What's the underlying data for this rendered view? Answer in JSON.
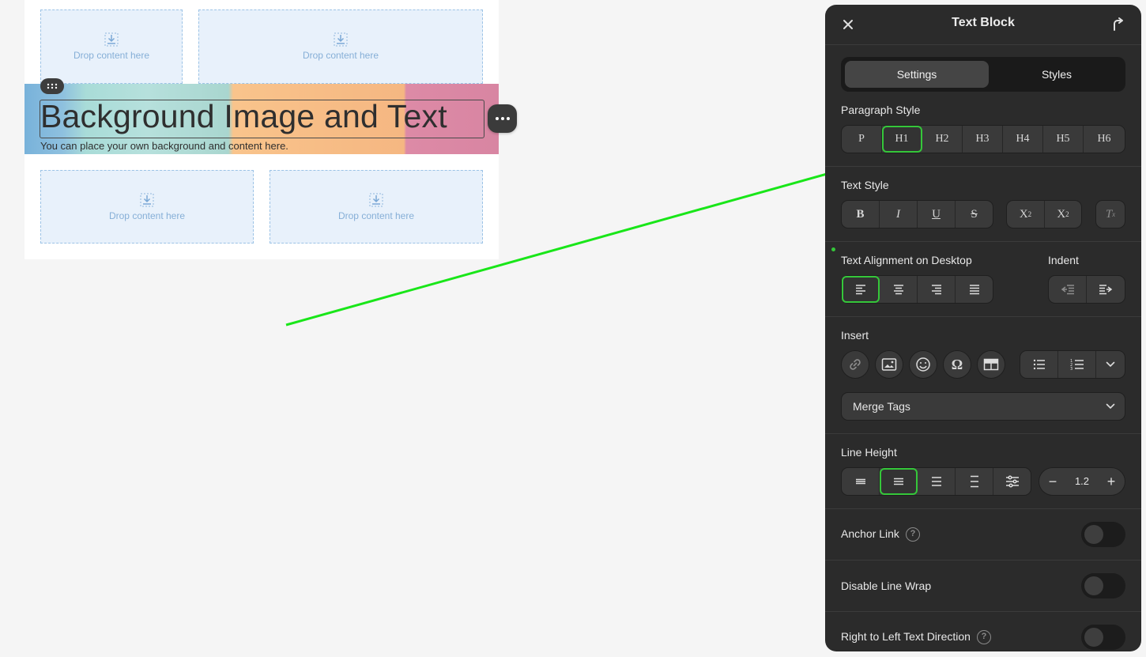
{
  "canvas": {
    "drop_text": "Drop content here",
    "bg_title": "Background Image and Text",
    "bg_subtitle": "You can place your own background and content here."
  },
  "panel": {
    "title": "Text Block",
    "tabs": [
      "Settings",
      "Styles"
    ],
    "active_tab": "Settings",
    "paragraph_style": {
      "label": "Paragraph Style",
      "options": [
        "P",
        "H1",
        "H2",
        "H3",
        "H4",
        "H5",
        "H6"
      ],
      "selected": "H1"
    },
    "text_style": {
      "label": "Text Style",
      "options": [
        "B",
        "I",
        "U",
        "S"
      ],
      "script": [
        "X",
        "X"
      ],
      "sub_mark": "2",
      "sup_mark": "2",
      "clear": "T",
      "clear_mark": "x"
    },
    "alignment": {
      "label": "Text Alignment on Desktop",
      "options": [
        "left-align-icon",
        "center-align-icon",
        "right-align-icon",
        "justify-icon"
      ],
      "selected": "left-align-icon"
    },
    "indent": {
      "label": "Indent",
      "options": [
        "outdent-icon",
        "indent-icon"
      ]
    },
    "insert": {
      "label": "Insert",
      "omega": "Ω",
      "icons": [
        "link-icon",
        "image-icon",
        "emoji-icon",
        "omega-icon",
        "table-icon"
      ],
      "list_icons": [
        "bullet-list-icon",
        "numbered-list-icon",
        "chevron-down-icon"
      ]
    },
    "merge_tags": {
      "label": "Merge Tags"
    },
    "line_height": {
      "label": "Line Height",
      "selected_index": 1,
      "value": "1.2",
      "minus": "−",
      "plus": "+"
    },
    "toggles": {
      "anchor_link": "Anchor Link",
      "disable_line_wrap": "Disable Line Wrap",
      "rtl": "Right to Left Text Direction",
      "help_mark": "?"
    }
  },
  "colors": {
    "accent": "#35c73a",
    "panel_bg": "#2b2b2b",
    "drop_bg": "#e8f1fb"
  }
}
